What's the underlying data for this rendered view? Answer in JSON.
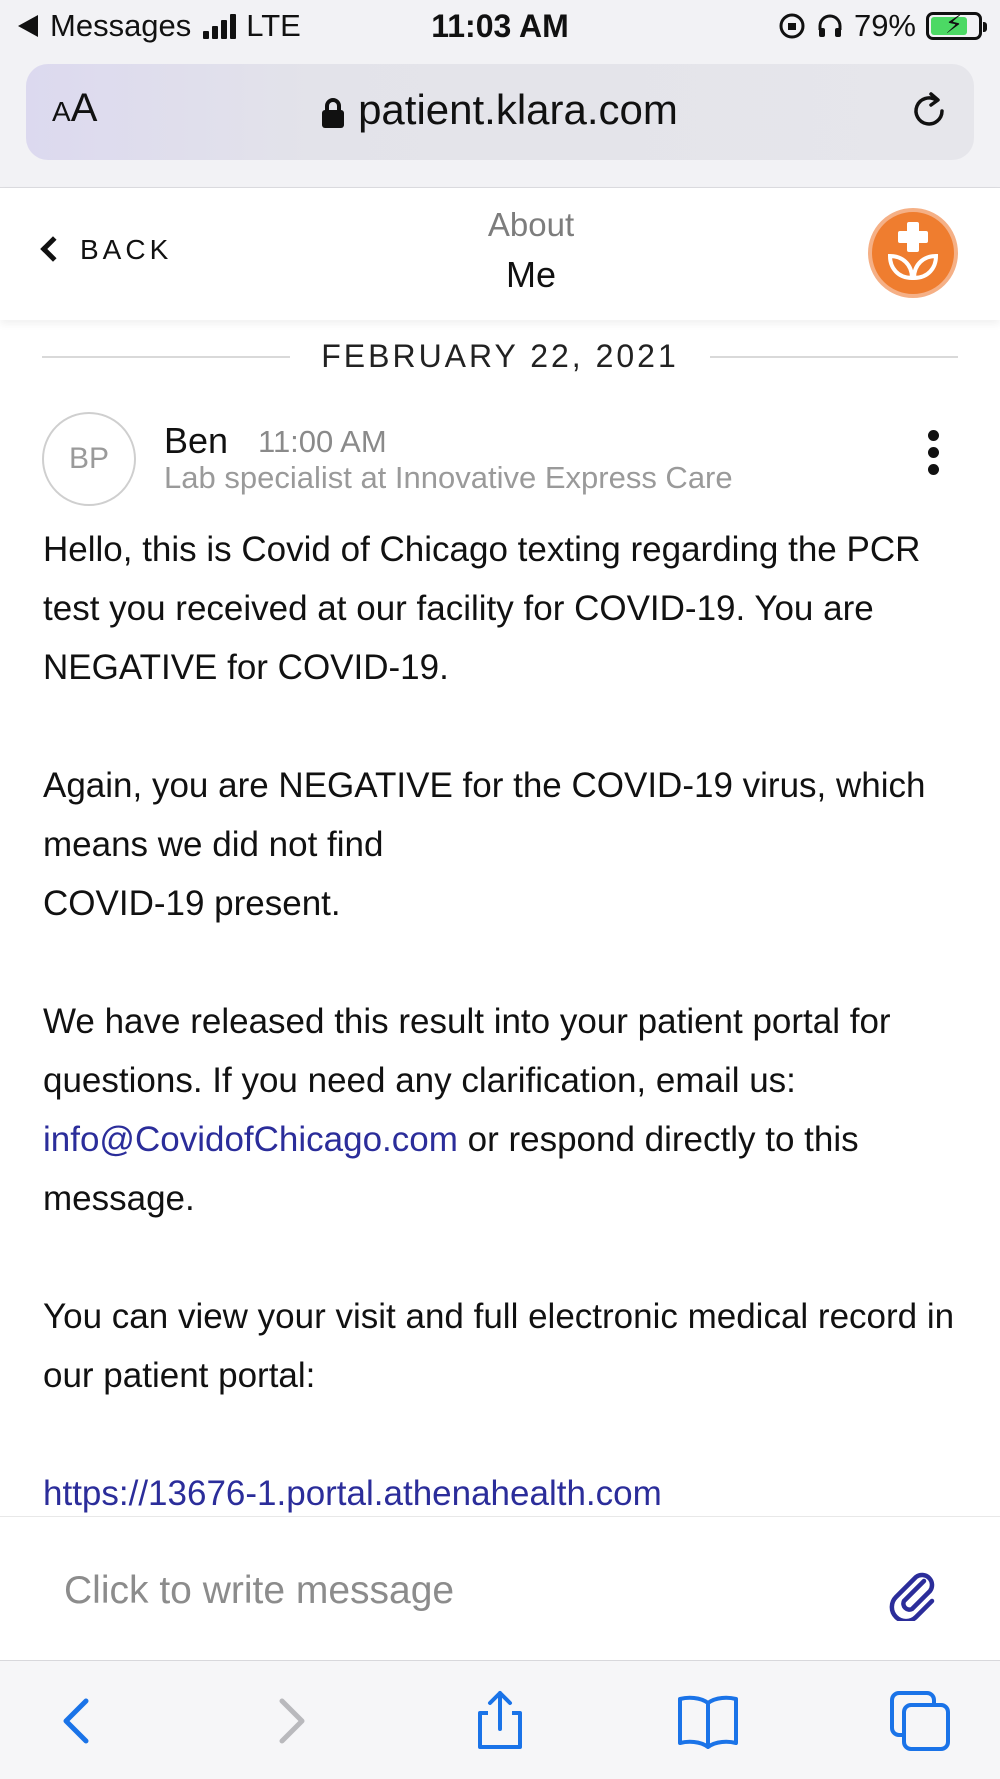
{
  "status_bar": {
    "back_app": "Messages",
    "network": "LTE",
    "time": "11:03 AM",
    "battery_percent": "79%",
    "battery_level": 0.79,
    "charging": true
  },
  "browser": {
    "text_size_label_small": "A",
    "text_size_label_large": "A",
    "url": "patient.klara.com"
  },
  "header": {
    "back_label": "BACK",
    "title_line1": "About",
    "title_line2": "Me",
    "logo_color": "#ef7d2f"
  },
  "conversation": {
    "date": "FEBRUARY 22, 2021",
    "sender": {
      "initials": "BP",
      "name": "Ben",
      "time": "11:00 AM",
      "role": "Lab specialist at Innovative Express Care"
    },
    "message": {
      "p1": "Hello, this is Covid of Chicago texting regarding the PCR test you received at our facility for COVID-19. You are NEGATIVE for COVID-19.",
      "p2_line1": "Again, you are NEGATIVE for the COVID-19 virus, which means we did not find",
      "p2_line2": "COVID-19 present.",
      "p3_before": "We have released this result into your patient portal for questions. If you need any clarification, email us: ",
      "p3_email": "info@CovidofChicago.com",
      "p3_after": " or respond directly to this message.",
      "p4": "You can view your visit and full electronic medical record in our patient portal:",
      "portal_link": "https://13676-1.portal.athenahealth.com"
    },
    "link_color": "#2b2d9a"
  },
  "composer": {
    "placeholder": "Click to write message"
  },
  "toolbar": {
    "accent_color": "#1a73e8",
    "icons": [
      "back-icon",
      "forward-icon",
      "share-icon",
      "bookmarks-icon",
      "tabs-icon"
    ]
  }
}
